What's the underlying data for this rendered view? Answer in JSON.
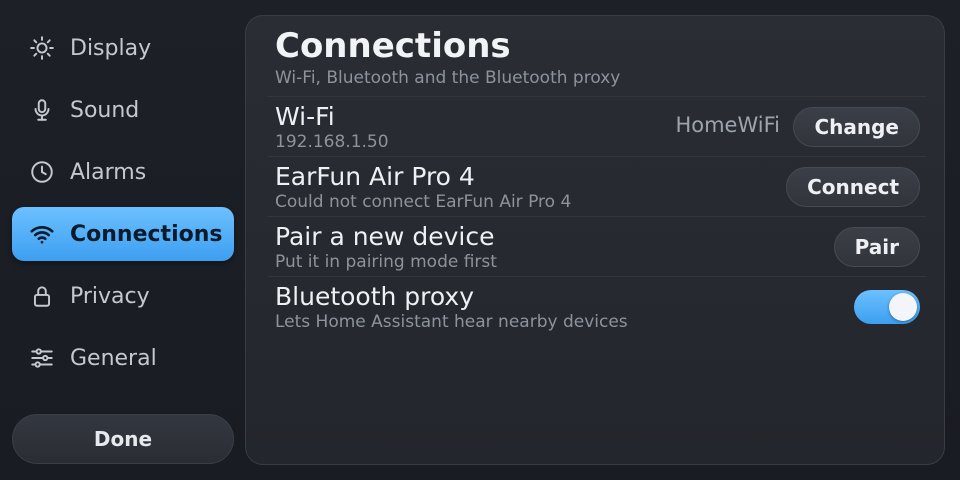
{
  "sidebar": {
    "items": [
      {
        "label": "Display",
        "icon": "sun-icon"
      },
      {
        "label": "Sound",
        "icon": "microphone-icon"
      },
      {
        "label": "Alarms",
        "icon": "clock-icon"
      },
      {
        "label": "Connections",
        "icon": "wifi-icon",
        "active": true
      },
      {
        "label": "Privacy",
        "icon": "lock-icon"
      },
      {
        "label": "General",
        "icon": "sliders-icon"
      }
    ],
    "done_label": "Done"
  },
  "panel": {
    "title": "Connections",
    "subtitle": "Wi‑Fi, Bluetooth and the Bluetooth proxy",
    "rows": {
      "wifi": {
        "title": "Wi‑Fi",
        "sub": "192.168.1.50",
        "value": "HomeWiFi",
        "button": "Change"
      },
      "earfun": {
        "title": "EarFun Air Pro 4",
        "sub": "Could not connect EarFun Air Pro 4",
        "button": "Connect"
      },
      "pair": {
        "title": "Pair a new device",
        "sub": "Put it in pairing mode first",
        "button": "Pair"
      },
      "proxy": {
        "title": "Bluetooth proxy",
        "sub": "Lets Home Assistant hear nearby devices",
        "toggle_on": true
      }
    }
  },
  "colors": {
    "accent": "#4aaaf5",
    "panel": "#2a2d34",
    "background": "#1b1e25"
  }
}
